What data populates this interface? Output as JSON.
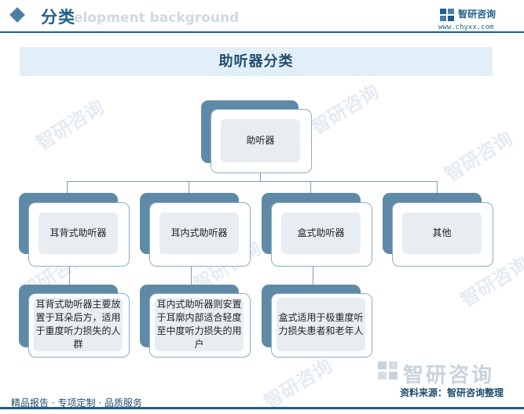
{
  "header": {
    "title": "分类",
    "background_text": "elopment background",
    "brand_name": "智研咨询",
    "brand_url": "www.chyxx.com"
  },
  "diagram": {
    "title": "助听器分类",
    "root": "助听器",
    "categories": [
      {
        "label": "耳背式助听器",
        "description": "耳背式助听器主要放置于耳朵后方，适用于重度听力损失的人群"
      },
      {
        "label": "耳内式助听器",
        "description": "耳内式助听器则安置于耳廓内部适合轻度至中度听力损失的用户"
      },
      {
        "label": "盒式助听器",
        "description": "盒式适用于极重度听力损失患者和老年人"
      },
      {
        "label": "其他",
        "description": ""
      }
    ]
  },
  "watermark": {
    "text": "智研咨询"
  },
  "footer": {
    "services": "精品报告 · 专项定制 · 品质服务",
    "source": "资料来源：智研咨询整理",
    "brand_name": "智研咨询"
  },
  "colors": {
    "primary": "#1f5f8b",
    "node_back": "#5f8aa7",
    "node_inner": "#e8edf2",
    "title_band": "#e3eff8"
  }
}
